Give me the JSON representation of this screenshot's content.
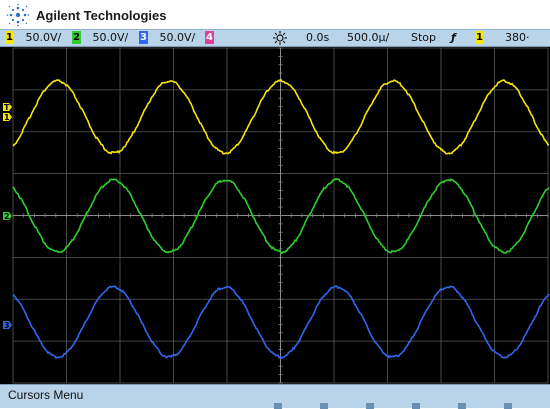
{
  "header": {
    "brand": "Agilent Technologies"
  },
  "status_bar": {
    "channels": [
      {
        "num": "1",
        "scale": "50.0V/",
        "color": "#f5e50b"
      },
      {
        "num": "2",
        "scale": "50.0V/",
        "color": "#2fcf2f"
      },
      {
        "num": "3",
        "scale": "50.0V/",
        "color": "#3366ee"
      },
      {
        "num": "4",
        "scale": "",
        "color": "#e0409a"
      }
    ],
    "delay": "0.0s",
    "timebase": "500.0µ/",
    "run_state": "Stop",
    "trigger_slope": "ƒ",
    "trigger_source": "1",
    "trigger_level": "380·"
  },
  "screen": {
    "markers": [
      {
        "label": "T",
        "color": "#f5e50b"
      },
      {
        "label": "1",
        "color": "#f5e50b"
      },
      {
        "label": "2",
        "color": "#2fcf2f"
      },
      {
        "label": "3",
        "color": "#3366ee"
      }
    ],
    "traces": [
      {
        "channel": "1",
        "color": "#f5e50b",
        "cycles": 4.8,
        "phase": 0.85
      },
      {
        "channel": "2",
        "color": "#2fcf2f",
        "cycles": 4.8,
        "phase": 0.35
      },
      {
        "channel": "3",
        "color": "#3366ee",
        "cycles": 4.8,
        "phase": 0.35
      }
    ]
  },
  "menu": {
    "title": "Cursors Menu"
  }
}
